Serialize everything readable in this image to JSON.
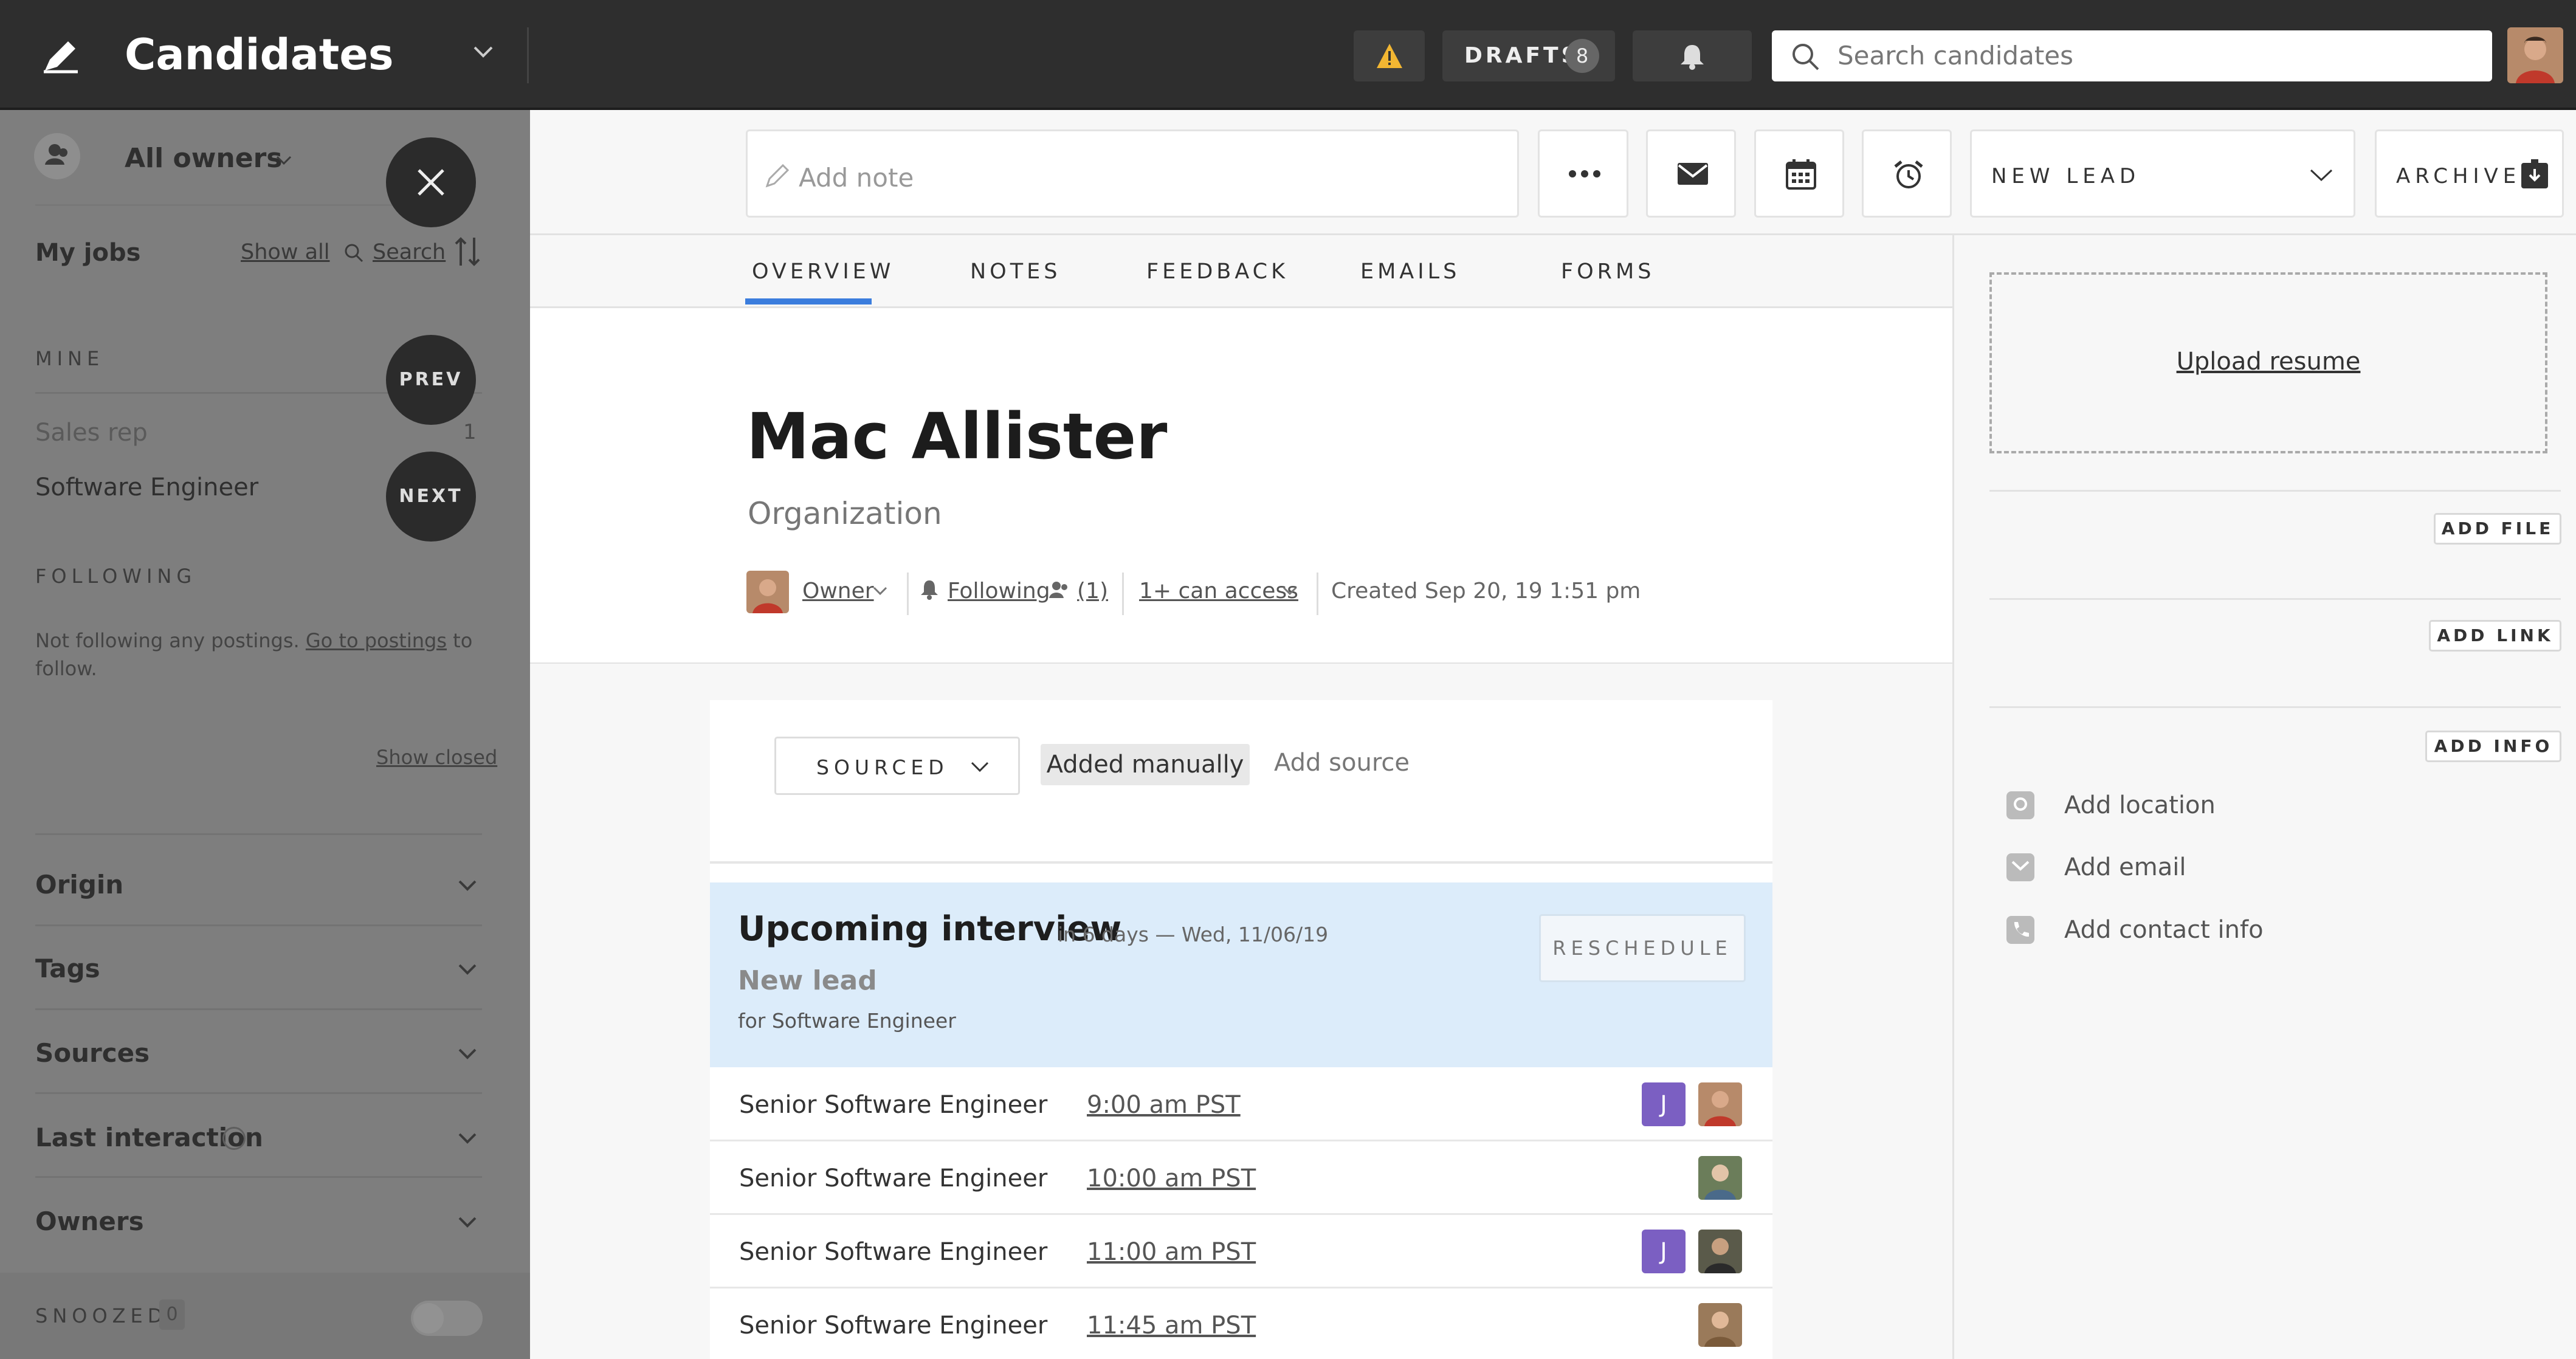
{
  "header": {
    "title": "Candidates",
    "drafts_label": "DRAFTS",
    "drafts_count": "8",
    "search_placeholder": "Search candidates"
  },
  "sidebar": {
    "owner_filter": "All owners",
    "my_jobs": "My jobs",
    "show_all": "Show all",
    "search": "Search",
    "mine_heading": "MINE",
    "mine_items": [
      {
        "label": "Sales rep",
        "count": "1"
      },
      {
        "label": "Software Engineer",
        "count": ""
      }
    ],
    "following_heading": "FOLLOWING",
    "following_text": "Not following any postings.",
    "following_link": "Go to postings",
    "following_suffix": "to",
    "following_suffix2": "follow.",
    "show_closed": "Show closed",
    "sections": [
      "Origin",
      "Tags",
      "Sources",
      "Last interaction",
      "Owners"
    ],
    "snoozed_label": "SNOOZED",
    "snoozed_count": "0",
    "prev_label": "PREV",
    "next_label": "NEXT"
  },
  "toolbar": {
    "add_note_placeholder": "Add note",
    "stage": "NEW LEAD",
    "archive": "ARCHIVE"
  },
  "tabs": [
    "OVERVIEW",
    "NOTES",
    "FEEDBACK",
    "EMAILS",
    "FORMS"
  ],
  "candidate": {
    "name": "Mac Allister",
    "organization": "Organization",
    "owner": "Owner",
    "following": "Following",
    "followers_count": "(1)",
    "access": "1+ can access",
    "created": "Created Sep 20, 19 1:51 pm"
  },
  "source": {
    "type": "SOURCED",
    "tag": "Added manually",
    "add_source": "Add source"
  },
  "interview": {
    "title": "Upcoming interview",
    "when": "in 6 days — Wed, 11/06/19",
    "stage": "New lead",
    "for_job": "for Software Engineer",
    "reschedule": "RESCHEDULE",
    "rows": [
      {
        "title": "Senior Software Engineer",
        "time": "9:00 am PST",
        "badge": "J"
      },
      {
        "title": "Senior Software Engineer",
        "time": "10:00 am PST",
        "badge": ""
      },
      {
        "title": "Senior Software Engineer",
        "time": "11:00 am PST",
        "badge": "J"
      },
      {
        "title": "Senior Software Engineer",
        "time": "11:45 am PST",
        "badge": ""
      }
    ]
  },
  "right_panel": {
    "upload_resume": "Upload resume",
    "add_file": "ADD FILE",
    "add_link": "ADD LINK",
    "add_info": "ADD INFO",
    "add_location": "Add location",
    "add_email": "Add email",
    "add_contact": "Add contact info"
  },
  "colors": {
    "topbar": "#2e2e2e",
    "sidebar_overlay": "#7e7e7e",
    "accent_tab": "#3b7ddd",
    "interview_bg": "#dcecfa",
    "badge_purple": "#7b5fc2"
  }
}
